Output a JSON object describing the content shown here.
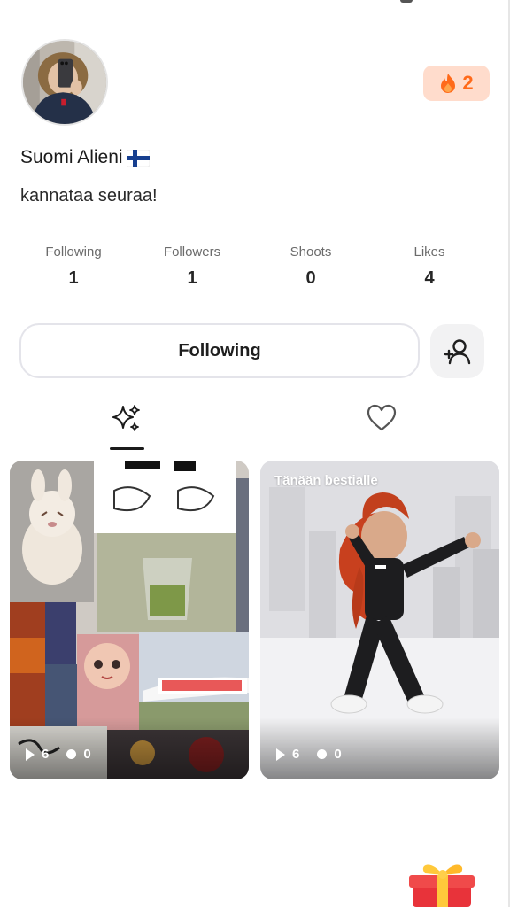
{
  "profile": {
    "display_name": "Suomi Alieni",
    "name_emoji_icon": "finland-flag-icon",
    "bio": "kannataa seuraa!",
    "avatar_icon": "profile-photo-avatar"
  },
  "streak": {
    "icon": "flame-icon",
    "count": "2",
    "accent_color": "#ff6a1a",
    "background_color": "#ffdccc"
  },
  "stats": [
    {
      "label": "Following",
      "value": "1"
    },
    {
      "label": "Followers",
      "value": "1"
    },
    {
      "label": "Shoots",
      "value": "0"
    },
    {
      "label": "Likes",
      "value": "4"
    }
  ],
  "actions": {
    "follow_label": "Following",
    "add_friend_icon": "add-user-icon"
  },
  "tabs": [
    {
      "icon": "sparkles-icon",
      "active": true
    },
    {
      "icon": "heart-icon",
      "active": false
    }
  ],
  "posts": [
    {
      "caption": "",
      "plays": "6",
      "comments": "0",
      "thumbnail": "photo-collage"
    },
    {
      "caption": "Tänään bestialle",
      "plays": "6",
      "comments": "0",
      "thumbnail": "dancing-avatar"
    }
  ],
  "floating": {
    "icon": "gift-box-icon"
  }
}
